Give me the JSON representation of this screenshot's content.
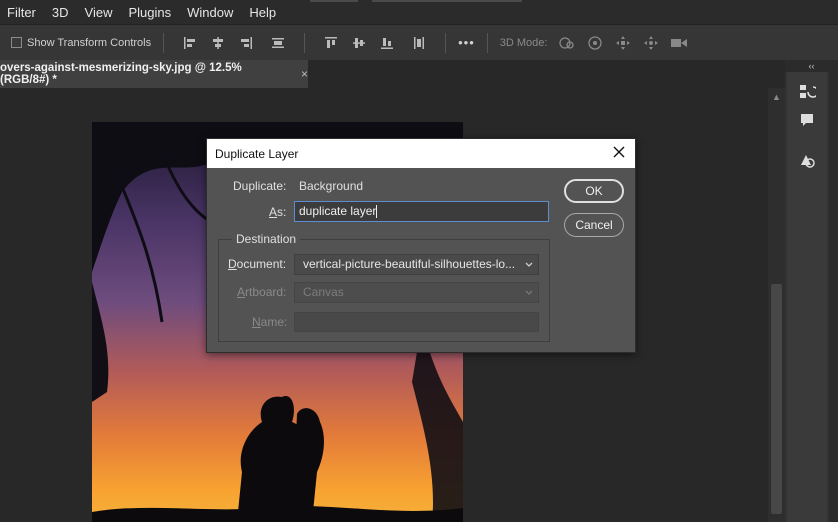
{
  "menu": {
    "items": [
      "Filter",
      "3D",
      "View",
      "Plugins",
      "Window",
      "Help"
    ]
  },
  "options_bar": {
    "show_transform_controls": "Show Transform Controls",
    "more_label": "•••",
    "mode_3d_label": "3D Mode:"
  },
  "document_tab": {
    "title": "overs-against-mesmerizing-sky.jpg @ 12.5% (RGB/8#) *",
    "close": "×"
  },
  "dock": {
    "collapse_label": "‹‹"
  },
  "dialog": {
    "title": "Duplicate Layer",
    "duplicate_label": "Duplicate:",
    "duplicate_value": "Background",
    "as_label_underlined": "A",
    "as_label_rest": "s:",
    "as_value": "duplicate layer",
    "ok_label": "OK",
    "cancel_label": "Cancel",
    "destination_label": "Destination",
    "document_label_underlined": "D",
    "document_label_rest": "ocument:",
    "document_value": "vertical-picture-beautiful-silhouettes-lo...",
    "artboard_label_underlined": "A",
    "artboard_label_rest": "rtboard:",
    "artboard_value": "Canvas",
    "name_label_underlined": "N",
    "name_label_rest": "ame:",
    "name_value": ""
  }
}
